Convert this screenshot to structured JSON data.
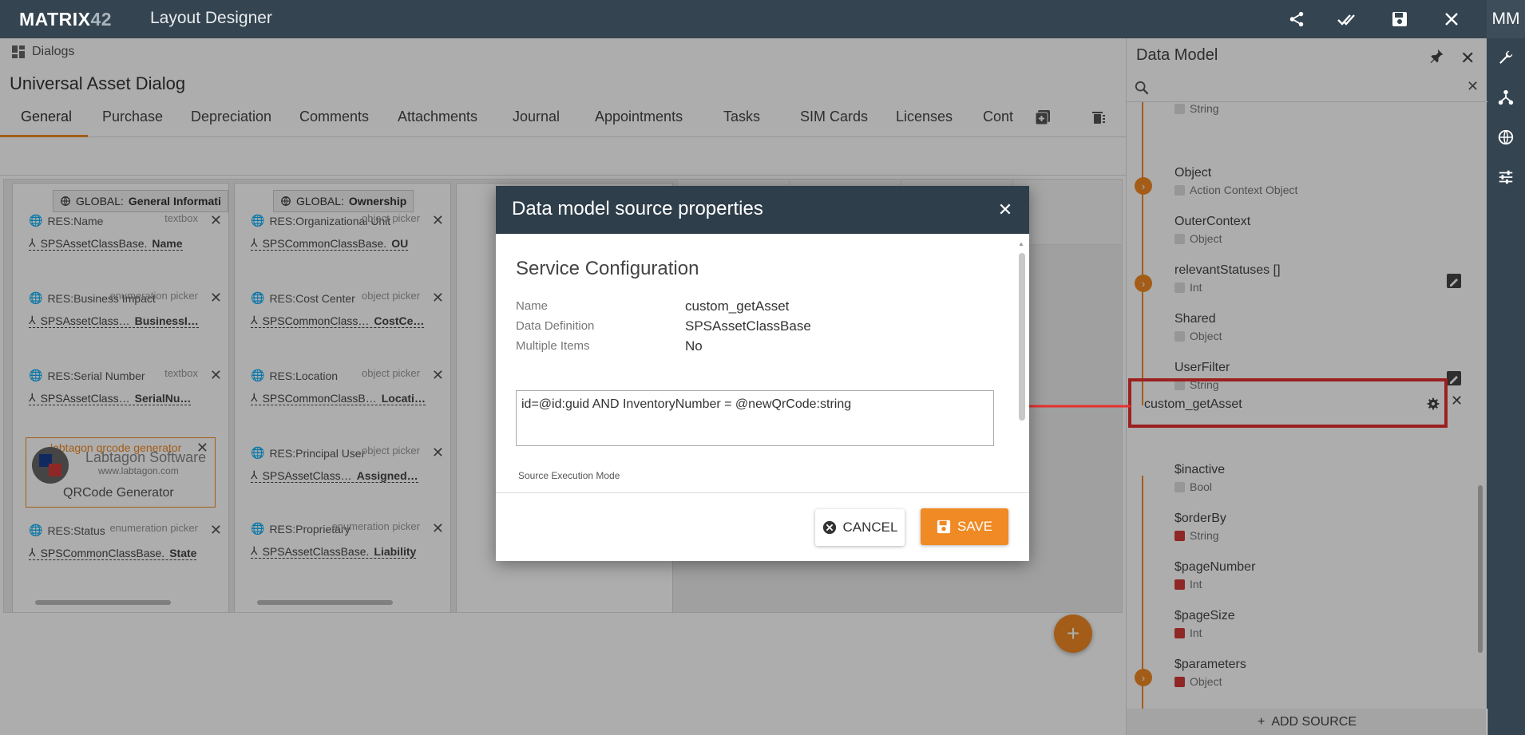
{
  "topbar": {
    "logo_a": "MATRIX",
    "logo_b": "42",
    "app_title": "Layout Designer",
    "user_initials": "MM"
  },
  "breadcrumb": {
    "label": "Dialogs"
  },
  "dialog_title": "Universal Asset Dialog",
  "tabs": [
    {
      "label": "General",
      "active": true
    },
    {
      "label": "Purchase"
    },
    {
      "label": "Depreciation"
    },
    {
      "label": "Comments"
    },
    {
      "label": "Attachments"
    },
    {
      "label": "Journal"
    },
    {
      "label": "Appointments"
    },
    {
      "label": "Tasks"
    },
    {
      "label": "SIM Cards"
    },
    {
      "label": "Licenses"
    },
    {
      "label": "Cont"
    }
  ],
  "columns": [
    {
      "header_prefix": "GLOBAL:",
      "header_name": "General Informati",
      "fields": [
        {
          "res": "RES:Name",
          "control": "textbox",
          "bind_prefix": "SPSAssetClassBase.",
          "bind_name": "Name"
        },
        {
          "res": "RES:Business Impact",
          "control": "enumeration picker",
          "bind_prefix": "SPSAssetClass…",
          "bind_name": "BusinessI…"
        },
        {
          "res": "RES:Serial Number",
          "control": "textbox",
          "bind_prefix": "SPSAssetClass…",
          "bind_name": "SerialNu…"
        },
        {
          "res": "RES:Status",
          "control": "enumeration picker",
          "bind_prefix": "SPSCommonClassBase.",
          "bind_name": "State"
        }
      ],
      "widget": {
        "title": "labtagon qrcode generator",
        "brand": "Labtagon Software",
        "url": "www.labtagon.com",
        "label": "QRCode Generator"
      }
    },
    {
      "header_prefix": "GLOBAL:",
      "header_name": "Ownership",
      "fields": [
        {
          "res": "RES:Organizational Unit",
          "control": "object picker",
          "bind_prefix": "SPSCommonClassBase.",
          "bind_name": "OU"
        },
        {
          "res": "RES:Cost Center",
          "control": "object picker",
          "bind_prefix": "SPSCommonClass…",
          "bind_name": "CostCe…"
        },
        {
          "res": "RES:Location",
          "control": "object picker",
          "bind_prefix": "SPSCommonClassB…",
          "bind_name": "Locati…"
        },
        {
          "res": "RES:Principal User",
          "control": "object picker",
          "bind_prefix": "SPSAssetClass…",
          "bind_name": "Assigned…"
        },
        {
          "res": "RES:Proprietary",
          "control": "enumeration picker",
          "bind_prefix": "SPSAssetClassBase.",
          "bind_name": "Liability"
        }
      ]
    }
  ],
  "data_model": {
    "title": "Data Model",
    "items_top": [
      {
        "name": "",
        "type": "String"
      },
      {
        "name": "Object",
        "type": "Action Context Object",
        "expandable": true
      },
      {
        "name": "OuterContext",
        "type": "Object"
      },
      {
        "name": "relevantStatuses []",
        "type": "Int",
        "expandable": true,
        "editable": true
      },
      {
        "name": "Shared",
        "type": "Object"
      },
      {
        "name": "UserFilter",
        "type": "String",
        "editable": true
      }
    ],
    "source_name": "custom_getAsset",
    "items_bottom": [
      {
        "name": "$inactive",
        "type": "Bool",
        "required": false
      },
      {
        "name": "$orderBy",
        "type": "String",
        "required": true
      },
      {
        "name": "$pageNumber",
        "type": "Int",
        "required": true
      },
      {
        "name": "$pageSize",
        "type": "Int",
        "required": true
      },
      {
        "name": "$parameters",
        "type": "Object",
        "required": true,
        "expandable": true
      }
    ],
    "add_source": "ADD SOURCE"
  },
  "modal": {
    "title": "Data model source properties",
    "section": "Service Configuration",
    "props": [
      {
        "label": "Name",
        "value": "custom_getAsset"
      },
      {
        "label": "Data Definition",
        "value": "SPSAssetClassBase"
      },
      {
        "label": "Multiple Items",
        "value": "No"
      }
    ],
    "filter": "id=@id:guid AND InventoryNumber = @newQrCode:string",
    "exec_label": "Source Execution Mode",
    "cancel": "CANCEL",
    "save": "SAVE"
  },
  "colors": {
    "header": "#344450",
    "accent": "#f08a24",
    "annotation": "#e63030",
    "required": "#d33a3a"
  }
}
